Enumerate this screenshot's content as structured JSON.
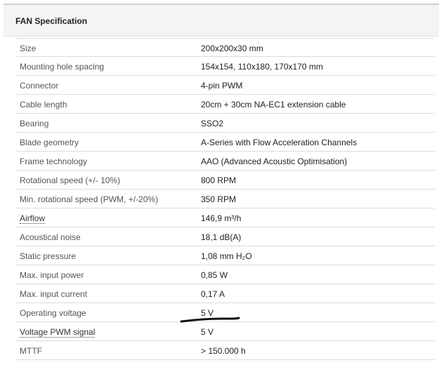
{
  "header": {
    "title": "FAN Specification"
  },
  "rows": [
    {
      "label": "Size",
      "value": "200x200x30 mm"
    },
    {
      "label": "Mounting hole spacing",
      "value": "154x154, 110x180, 170x170 mm"
    },
    {
      "label": "Connector",
      "value": "4-pin PWM"
    },
    {
      "label": "Cable length",
      "value": "20cm + 30cm NA-EC1 extension cable"
    },
    {
      "label": "Bearing",
      "value": "SSO2"
    },
    {
      "label": "Blade geometry",
      "value": "A-Series with Flow Acceleration Channels"
    },
    {
      "label": "Frame technology",
      "value": "AAO (Advanced Acoustic Optimisation)"
    },
    {
      "label": "Rotational speed (+/- 10%)",
      "value": "800 RPM"
    },
    {
      "label": "Min. rotational speed (PWM, +/-20%)",
      "value": "350 RPM"
    },
    {
      "label": "Airflow",
      "value": "146,9 m³/h"
    },
    {
      "label": "Acoustical noise",
      "value": "18,1 dB(A)"
    },
    {
      "label": "Static pressure",
      "value": "1,08 mm H₂O"
    },
    {
      "label": "Max. input power",
      "value": "0,85 W"
    },
    {
      "label": "Max. input current",
      "value": "0,17 A"
    },
    {
      "label": "Operating voltage",
      "value": "5 V"
    },
    {
      "label": "Voltage PWM signal",
      "value": "5 V"
    },
    {
      "label": "MTTF",
      "value": "> 150.000 h"
    }
  ],
  "colors": {
    "header_bg": "#f4f4f4",
    "row_divider": "#dcdcdc",
    "annotation_ink": "#111111"
  }
}
